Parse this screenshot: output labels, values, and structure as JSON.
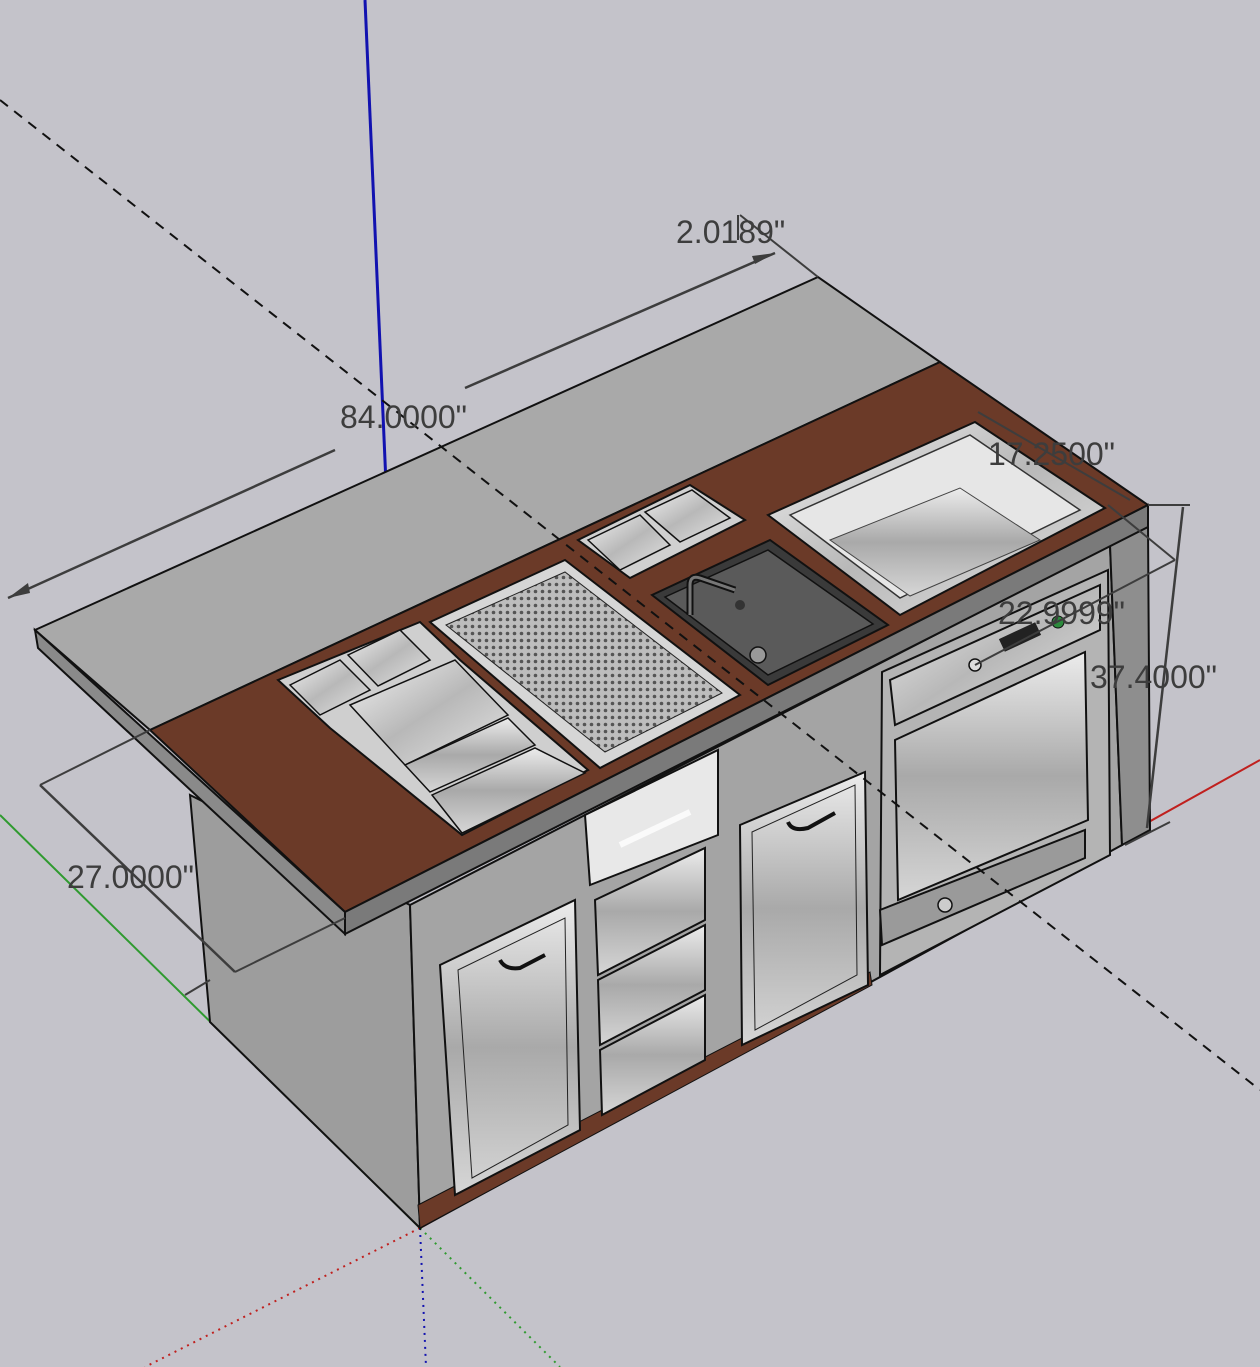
{
  "canvas": {
    "background_color": "#c4c3ca"
  },
  "colors": {
    "countertop_gray": "#a9a9a9",
    "countertop_wood": "#6b3a28",
    "cabinet_gray": "#9e9e9e",
    "stainless": "#d9d9d9",
    "axis_red": "#c0201e",
    "axis_green": "#2f9a2f",
    "axis_blue": "#1212b0",
    "dimension_line": "#3d3d3d"
  },
  "dimensions": {
    "top_depth": "2.0189\"",
    "overall_length": "84.0000\"",
    "sink_width": "17.2500\"",
    "appliance_depth": "22.9999\"",
    "height": "37.4000\"",
    "depth": "27.0000\""
  },
  "model": {
    "countertop": {
      "overhang_material": "gray solid surface",
      "inlay_material": "wood"
    },
    "fixtures": [
      "cold-plate-cooler",
      "perforated-drainboard",
      "garnish-tray",
      "bar-sink",
      "faucet",
      "ice-bin",
      "glass-washer",
      "storage-cabinet-left",
      "drawers",
      "storage-cabinet-right"
    ]
  }
}
